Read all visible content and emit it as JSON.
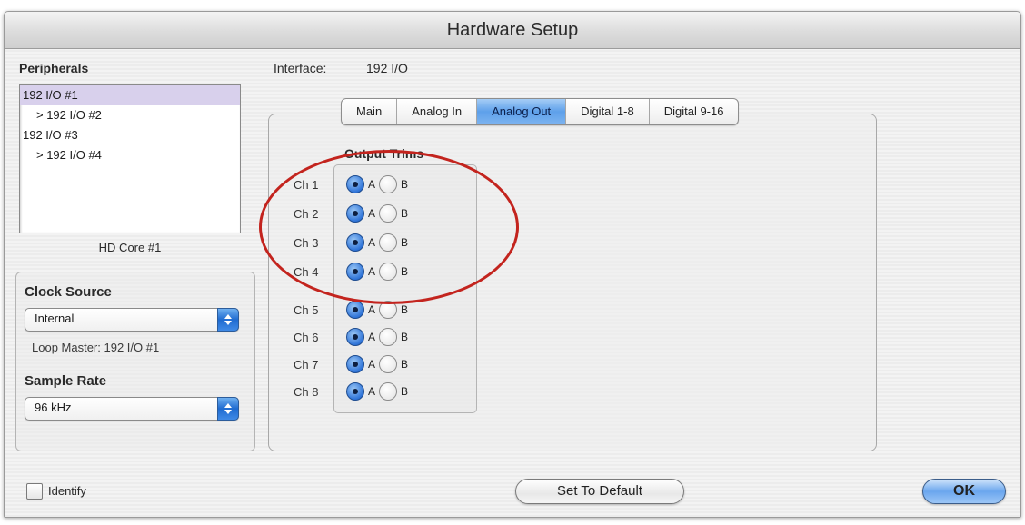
{
  "window": {
    "title": "Hardware Setup"
  },
  "peripherals": {
    "label": "Peripherals",
    "items": [
      {
        "label": "192 I/O #1",
        "selected": true,
        "child": false
      },
      {
        "label": "> 192 I/O #2",
        "selected": false,
        "child": true
      },
      {
        "label": "192 I/O #3",
        "selected": false,
        "child": false
      },
      {
        "label": "> 192 I/O #4",
        "selected": false,
        "child": true
      }
    ],
    "core_label": "HD Core #1"
  },
  "interface": {
    "label": "Interface:",
    "value": "192 I/O"
  },
  "tabs": [
    {
      "label": "Main",
      "active": false
    },
    {
      "label": "Analog In",
      "active": false
    },
    {
      "label": "Analog Out",
      "active": true
    },
    {
      "label": "Digital 1-8",
      "active": false
    },
    {
      "label": "Digital 9-16",
      "active": false
    }
  ],
  "output_trims": {
    "title": "Output Trims",
    "option_a": "A",
    "option_b": "B",
    "channels": [
      {
        "label": "Ch 1",
        "selected": "A"
      },
      {
        "label": "Ch 2",
        "selected": "A"
      },
      {
        "label": "Ch 3",
        "selected": "A"
      },
      {
        "label": "Ch 4",
        "selected": "A"
      },
      {
        "label": "Ch 5",
        "selected": "A"
      },
      {
        "label": "Ch 6",
        "selected": "A"
      },
      {
        "label": "Ch 7",
        "selected": "A"
      },
      {
        "label": "Ch 8",
        "selected": "A"
      }
    ]
  },
  "clock": {
    "label": "Clock Source",
    "value": "Internal",
    "loop_master": "Loop Master: 192 I/O #1"
  },
  "sample_rate": {
    "label": "Sample Rate",
    "value": "96 kHz"
  },
  "footer": {
    "identify_label": "Identify",
    "identify_checked": false,
    "default_button": "Set To Default",
    "ok_button": "OK"
  },
  "colors": {
    "accent": "#5ea0ea",
    "callout": "#c3241e",
    "selection": "#d8d0ec"
  }
}
